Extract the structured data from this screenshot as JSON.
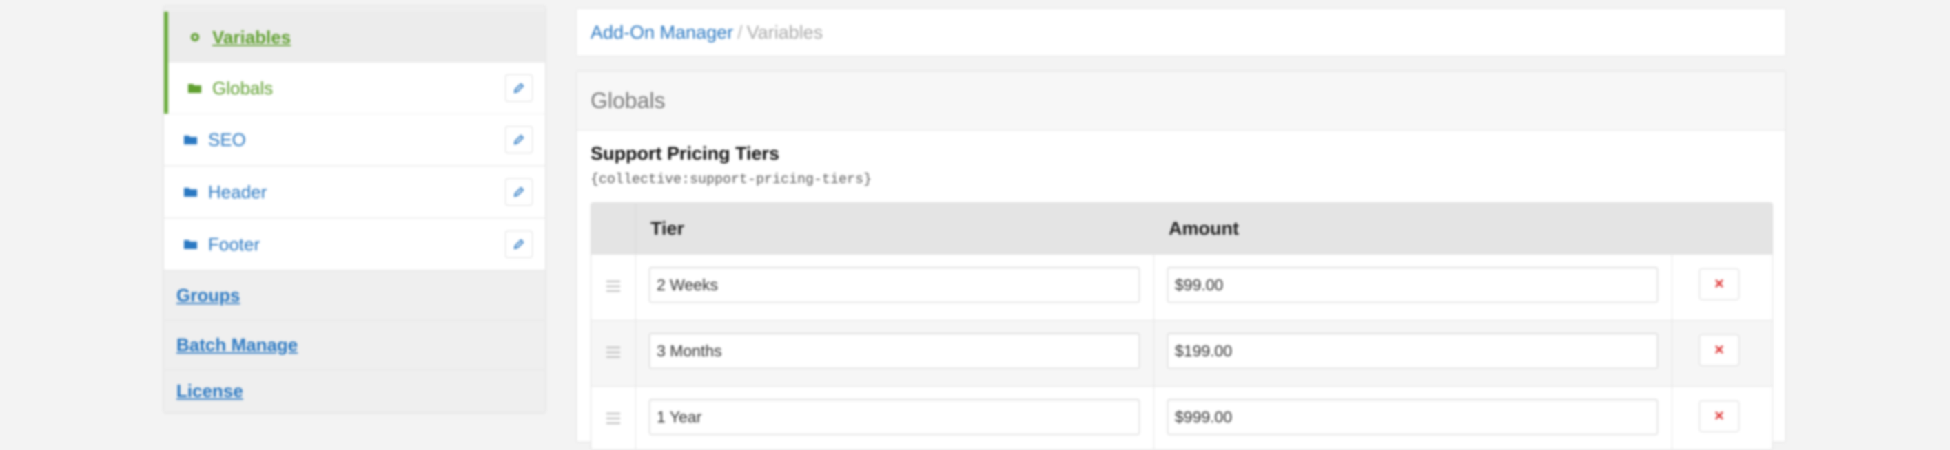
{
  "sidebar": {
    "variables_label": "Variables",
    "globals_label": "Globals",
    "seo_label": "SEO",
    "header_label": "Header",
    "footer_label": "Footer",
    "groups_label": "Groups",
    "batch_manage_label": "Batch Manage",
    "license_label": "License"
  },
  "breadcrumb": {
    "root": "Add-On Manager",
    "separator": "/",
    "current": "Variables"
  },
  "panel": {
    "title": "Globals",
    "variable_name": "Support Pricing Tiers",
    "variable_tag": "{collective:support-pricing-tiers}"
  },
  "table": {
    "headers": {
      "tier": "Tier",
      "amount": "Amount"
    },
    "rows": [
      {
        "tier": "2 Weeks",
        "amount": "$99.00"
      },
      {
        "tier": "3 Months",
        "amount": "$199.00"
      },
      {
        "tier": "1 Year",
        "amount": "$999.00"
      }
    ],
    "delete_symbol": "×"
  },
  "colors": {
    "accent_green": "#6cad3e",
    "link_blue": "#2a78c2",
    "delete_red": "#dd3333"
  },
  "icons": {
    "section": "gear-icon",
    "folder": "folder-icon",
    "edit": "pencil-icon",
    "drag": "drag-handle-icon",
    "delete": "close-icon"
  }
}
